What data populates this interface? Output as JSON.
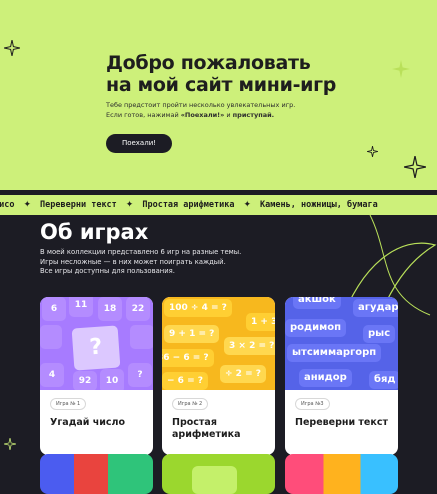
{
  "hero": {
    "title_line1": "Добро пожаловать",
    "title_line2": "на мой сайт мини-игр",
    "desc_line1": "Тебе предстоит пройти несколько увлекательных игр.",
    "desc_line2_a": "Если готов, нажимай ",
    "desc_line2_b": "«Поехали!»",
    "desc_line2_c": " и ",
    "desc_line2_d": "приступай.",
    "button": "Поехали!"
  },
  "ticker": {
    "items": [
      "чисо",
      "Переверни текст",
      "Простая арифметика",
      "Переверни текст",
      "Простая арифметика",
      "Камень, ножницы, бумага"
    ]
  },
  "about": {
    "title": "Об играх",
    "desc_line1": "В моей коллекции представлено 6 игр на разные темы.",
    "desc_line2": "Игры несложные — в них может поиграть каждый.",
    "desc_line3": "Все игры доступны для пользования."
  },
  "cards": [
    {
      "tag": "Игра № 1",
      "title": "Угадай число",
      "glyphs": [
        "6",
        "11",
        "18",
        "22",
        "?",
        "4",
        "92",
        "10",
        "?"
      ]
    },
    {
      "tag": "Игра № 2",
      "title": "Простая арифметика",
      "glyphs": [
        "100 ÷ 4 = ?",
        "1 + 3",
        "9 + 1 = ?",
        "36 − 6 = ?",
        "3 × 2 = ?",
        "− 6 = ?",
        "÷ 2 = ?"
      ]
    },
    {
      "tag": "Игра №3",
      "title": "Переверни текст",
      "glyphs": [
        "акшок",
        "агудар",
        "родимоп",
        "рыс",
        "ытсиммаргорп",
        "анидор",
        "бяд"
      ]
    }
  ],
  "colors": {
    "lime": "#cdf07a",
    "dark": "#1c1c24",
    "purple": "#b48cff",
    "yellow": "#ffd23c",
    "blue": "#6a76f6"
  }
}
